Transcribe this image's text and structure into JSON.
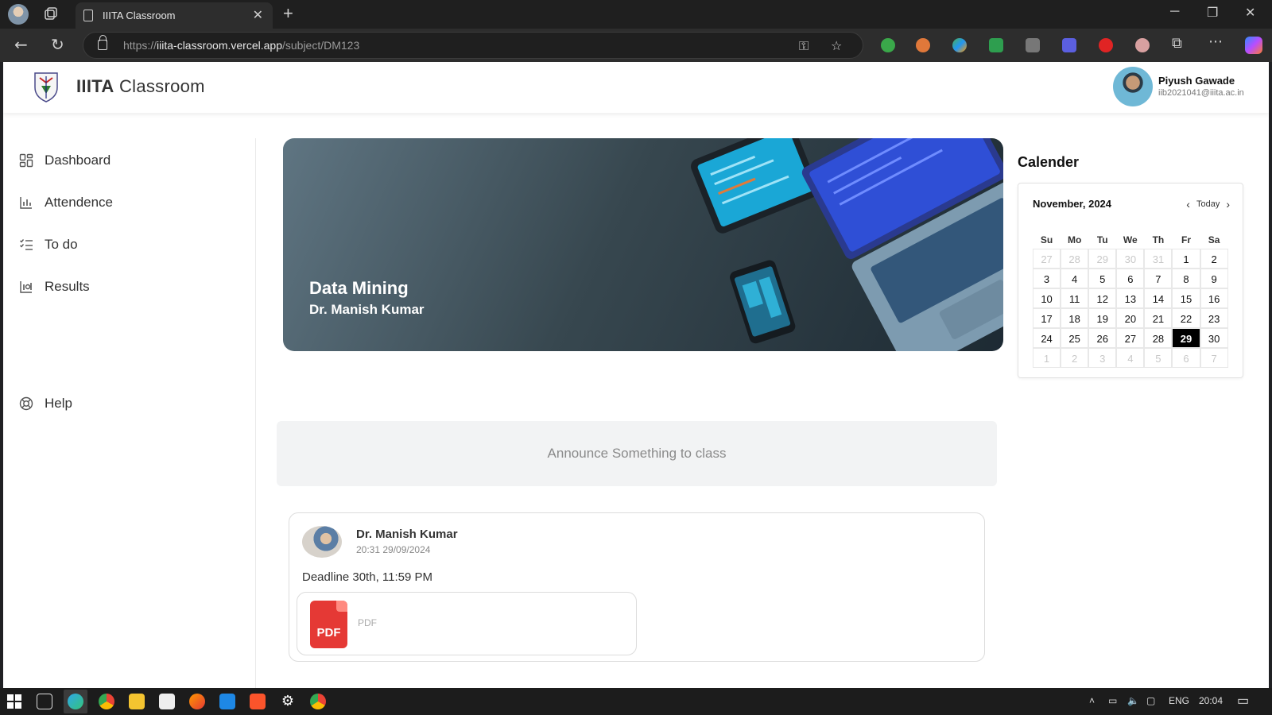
{
  "browser": {
    "tab_title": "IIITA Classroom",
    "url_prefix": "https://",
    "url_host": "iiita-classroom.vercel.app",
    "url_path": "/subject/DM123"
  },
  "header": {
    "brand_bold": "IIITA",
    "brand_rest": "Classroom",
    "user_name": "Piyush Gawade",
    "user_email": "iib2021041@iiita.ac.in"
  },
  "sidebar": {
    "items": [
      {
        "label": "Dashboard",
        "icon": "grid-icon"
      },
      {
        "label": "Attendence",
        "icon": "bar-chart-icon"
      },
      {
        "label": "To do",
        "icon": "checklist-icon"
      },
      {
        "label": "Results",
        "icon": "results-icon"
      }
    ],
    "help": {
      "label": "Help",
      "icon": "lifebuoy-icon"
    }
  },
  "banner": {
    "subject": "Data Mining",
    "teacher": "Dr. Manish Kumar"
  },
  "calendar": {
    "heading": "Calender",
    "month_label": "November, 2024",
    "today_label": "Today",
    "weekdays": [
      "Su",
      "Mo",
      "Tu",
      "We",
      "Th",
      "Fr",
      "Sa"
    ],
    "weeks": [
      [
        "27",
        "28",
        "29",
        "30",
        "31",
        "1",
        "2"
      ],
      [
        "3",
        "4",
        "5",
        "6",
        "7",
        "8",
        "9"
      ],
      [
        "10",
        "11",
        "12",
        "13",
        "14",
        "15",
        "16"
      ],
      [
        "17",
        "18",
        "19",
        "20",
        "21",
        "22",
        "23"
      ],
      [
        "24",
        "25",
        "26",
        "27",
        "28",
        "29",
        "30"
      ],
      [
        "1",
        "2",
        "3",
        "4",
        "5",
        "6",
        "7"
      ]
    ],
    "selected_day": "29"
  },
  "announce": {
    "placeholder": "Announce Something to class"
  },
  "post": {
    "author": "Dr. Manish Kumar",
    "timestamp": "20:31 29/09/2024",
    "text": "Deadline 30th, 11:59 PM",
    "attachment_icon_text": "PDF",
    "attachment_label": "PDF"
  },
  "taskbar": {
    "language": "ENG",
    "time": "20:04"
  },
  "colors": {
    "accent_selected": "#000000",
    "pdf_red": "#e53935"
  }
}
